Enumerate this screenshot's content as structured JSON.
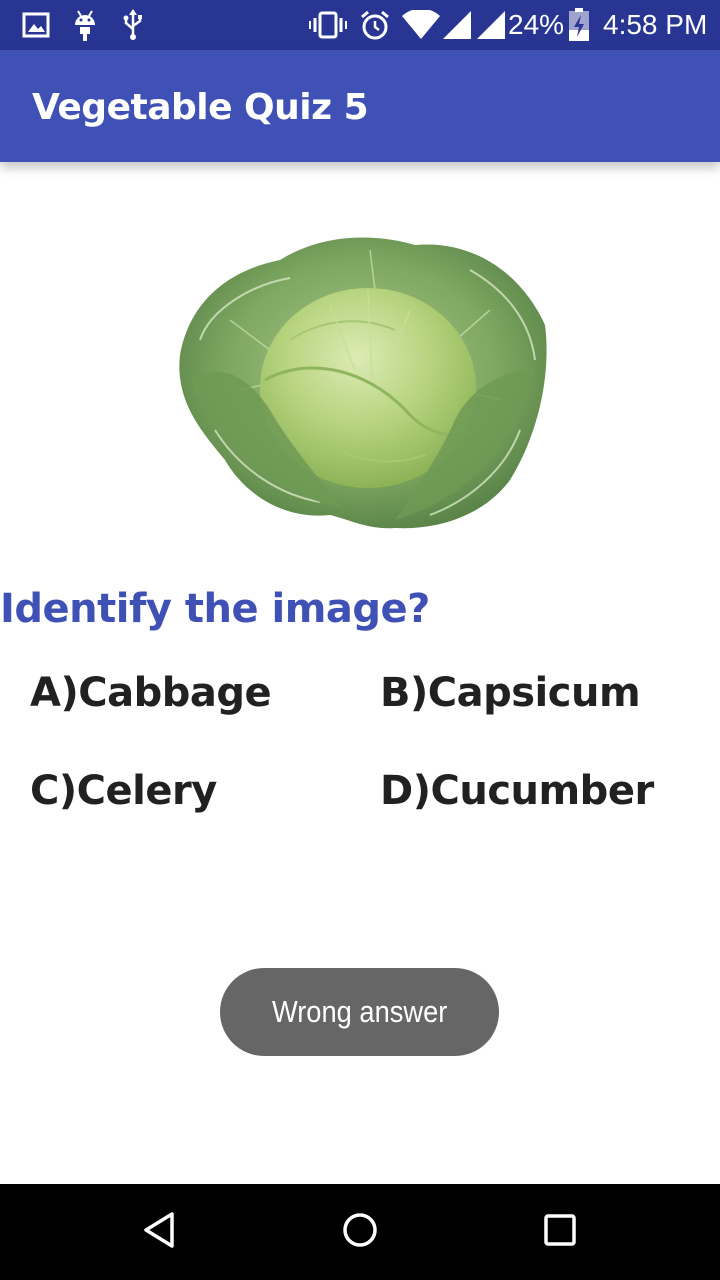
{
  "status_bar": {
    "battery_percent": "24%",
    "time": "4:58 PM",
    "icons": [
      "image-icon",
      "android-icon",
      "usb-icon",
      "vibrate-icon",
      "alarm-icon",
      "wifi-icon",
      "signal-icon",
      "battery-charging-icon"
    ]
  },
  "app_bar": {
    "title": "Vegetable Quiz 5",
    "color": "#3f51b5"
  },
  "quiz": {
    "image": "cabbage-image",
    "question": "Identify the image?",
    "options": [
      {
        "label": "A)Cabbage"
      },
      {
        "label": "B)Capsicum"
      },
      {
        "label": "C)Celery"
      },
      {
        "label": "D)Cucumber"
      }
    ]
  },
  "toast": {
    "message": "Wrong answer"
  },
  "nav_bar": {
    "buttons": [
      "back-icon",
      "home-icon",
      "recents-icon"
    ]
  }
}
